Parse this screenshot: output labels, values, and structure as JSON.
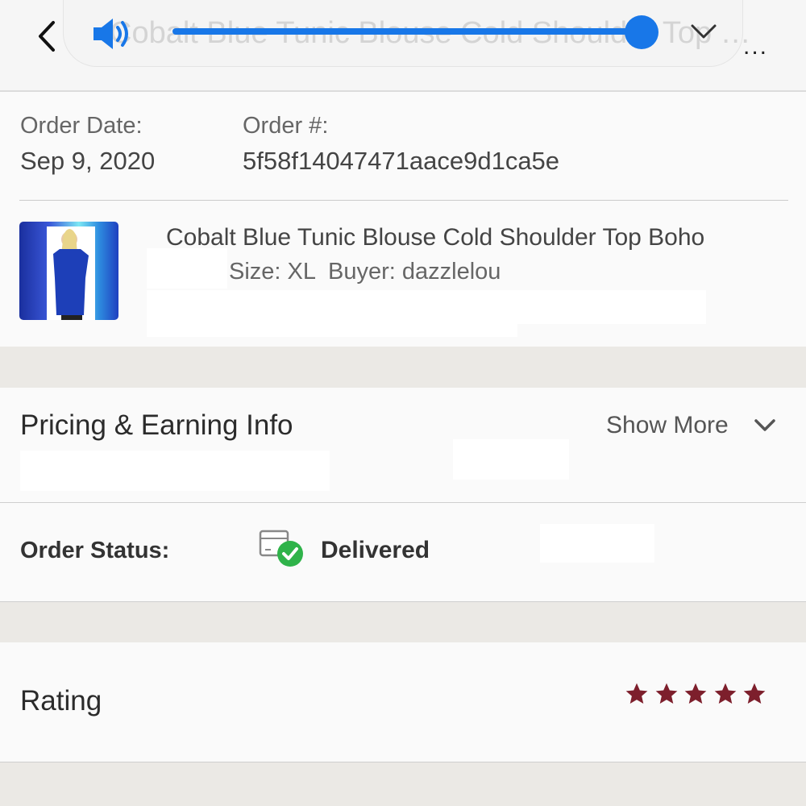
{
  "header": {
    "title": "Cobalt Blue Tunic Blouse Cold Shoulder Top Boho",
    "volume_level": 1.0,
    "more_label": "..."
  },
  "order": {
    "date_label": "Order Date:",
    "date_value": "Sep 9, 2020",
    "number_label": "Order #:",
    "number_value": "5f58f14047471aace9d1ca5e"
  },
  "item": {
    "title": "Cobalt Blue Tunic Blouse Cold Shoulder Top Boho",
    "details": "Size: XL  Buyer: dazzlelou"
  },
  "pricing": {
    "title": "Pricing & Earning Info",
    "show_more": "Show More"
  },
  "status": {
    "label": "Order Status:",
    "value": "Delivered"
  },
  "rating": {
    "title": "Rating",
    "stars": 5,
    "max": 5,
    "star_color": "#7d1f2c"
  },
  "colors": {
    "accent": "#1877e8",
    "success": "#2fb34a"
  }
}
